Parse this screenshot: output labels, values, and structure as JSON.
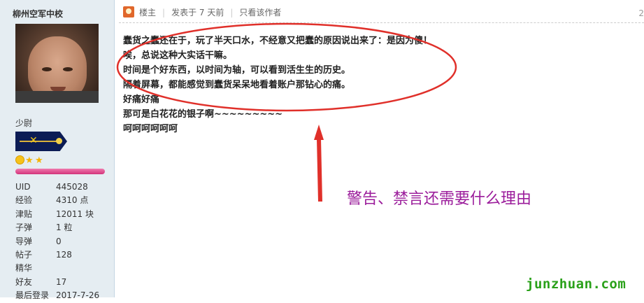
{
  "user": {
    "name": "柳州空军中校",
    "rank": "少尉",
    "stats": [
      {
        "label": "UID",
        "value": "445028"
      },
      {
        "label": "经验",
        "value": "4310 点"
      },
      {
        "label": "津贴",
        "value": "12011 块"
      },
      {
        "label": "子弹",
        "value": "1 粒"
      },
      {
        "label": "导弹",
        "value": "0"
      },
      {
        "label": "帖子",
        "value": "128"
      },
      {
        "label": "精华",
        "value": ""
      },
      {
        "label": "好友",
        "value": "17"
      },
      {
        "label": "最后登录",
        "value": "2017-7-26"
      }
    ]
  },
  "post_header": {
    "floor_label": "楼主",
    "posted_label": "发表于 7 天前",
    "author_only_label": "只看该作者",
    "corner_number": "2"
  },
  "post_body": [
    "蠢货之蠢还在于，玩了半天口水，不经意又把蠢的原因说出来了：是因为傻！",
    "唉，总说这种大实话干嘛。",
    "时间是个好东西，以时间为轴，可以看到活生生的历史。",
    "隔着屏幕，都能感觉到蠢货呆呆地看着账户那钻心的痛。",
    "好痛好痛",
    "那可是白花花的银子啊~~~~~~~~~",
    "呵呵呵呵呵呵"
  ],
  "annotation": {
    "text": "警告、禁言还需要什么理由",
    "color": "#9b1c9b",
    "ellipse_color": "#e0302a"
  },
  "watermark": "junzhuan.com",
  "colors": {
    "sidebar_bg": "#e5edf2",
    "watermark": "#2aa11a",
    "rank_badge": "#0c1c55"
  }
}
